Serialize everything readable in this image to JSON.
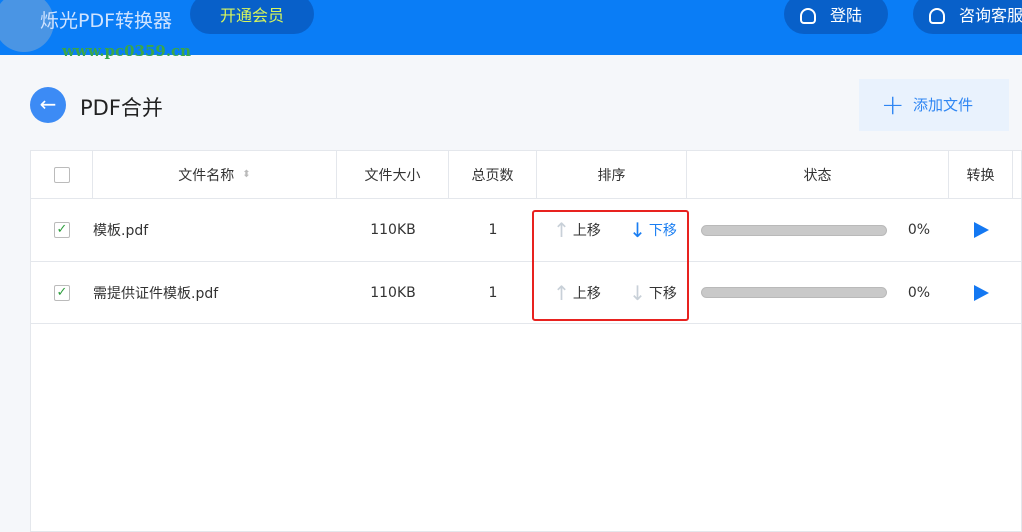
{
  "app": {
    "title": "烁光PDF转换器",
    "vip": "开通会员",
    "watermark": "www.pc0359.cn",
    "login": "登陆",
    "support": "咨询客服"
  },
  "page": {
    "title": "PDF合并",
    "add_file": "添加文件"
  },
  "table": {
    "headers": [
      "文件名称",
      "文件大小",
      "总页数",
      "排序",
      "状态",
      "转换"
    ],
    "rows": [
      {
        "name": "模板.pdf",
        "size": "110KB",
        "pages": "1",
        "up": "上移",
        "down": "下移",
        "progress": "0%",
        "checked": true
      },
      {
        "name": "需提供证件模板.pdf",
        "size": "110KB",
        "pages": "1",
        "up": "上移",
        "down": "下移",
        "progress": "0%",
        "checked": true
      }
    ]
  },
  "colors": {
    "accent": "#0a7df6",
    "highlight": "#e8221f"
  }
}
